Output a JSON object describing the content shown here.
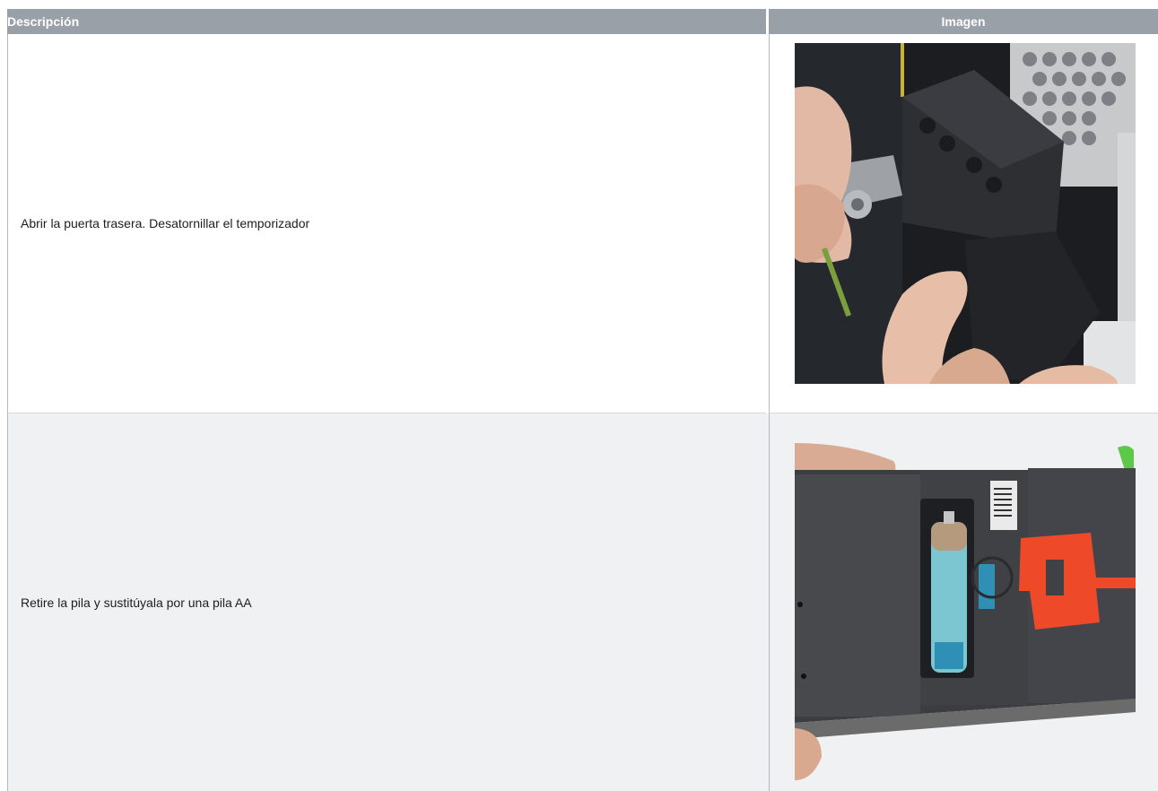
{
  "table": {
    "headers": {
      "description": "Descripción",
      "image": "Imagen"
    },
    "rows": [
      {
        "description": "Abrir la puerta trasera. Desatornillar el temporizador",
        "image_content": "hands-unscrewing-timer-photo"
      },
      {
        "description": "Retire la pila y sustitúyala por una pila AA",
        "image_content": "battery-compartment-photo"
      }
    ]
  },
  "colors": {
    "header_bg": "#99a0a8",
    "header_text": "#ffffff",
    "row_alt_bg": "#eff1f3",
    "orange_clip": "#ee4a2a"
  }
}
